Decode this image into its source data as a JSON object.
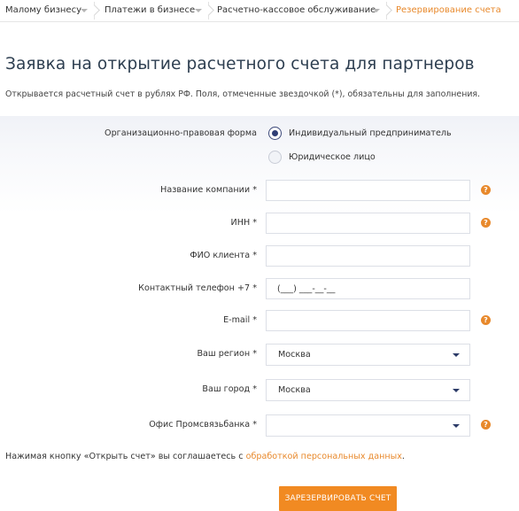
{
  "breadcrumb": {
    "items": [
      {
        "label": "Малому бизнесу"
      },
      {
        "label": "Платежи в бизнесе"
      },
      {
        "label": "Расчетно-кассовое обслуживание"
      },
      {
        "label": "Резервирование счета"
      }
    ]
  },
  "page": {
    "title": "Заявка на открытие расчетного счета для партнеров",
    "note": "Открывается расчетный счет в рублях РФ. Поля, отмеченные звездочкой (*), обязательны для заполнения."
  },
  "form": {
    "legal_form": {
      "label": "Организационно-правовая форма",
      "options": [
        {
          "label": "Индивидуальный предприниматель",
          "selected": true
        },
        {
          "label": "Юридическое лицо",
          "selected": false
        }
      ]
    },
    "company_name": {
      "label": "Название компании *",
      "value": ""
    },
    "inn": {
      "label": "ИНН *",
      "value": ""
    },
    "client_name": {
      "label": "ФИО клиента *",
      "value": ""
    },
    "phone": {
      "label": "Контактный телефон +7 *",
      "placeholder": "(___) ___-__-__"
    },
    "email": {
      "label": "E-mail *",
      "value": ""
    },
    "region": {
      "label": "Ваш регион  *",
      "value": "Москва"
    },
    "city": {
      "label": "Ваш город  *",
      "value": "Москва"
    },
    "office": {
      "label": "Офис Промсвязьбанка  *",
      "value": ""
    }
  },
  "help_icon_glyph": "?",
  "consent": {
    "text": "Нажимая кнопку «Открыть счет» вы соглашаетесь с ",
    "link": "обработкой персональных данных",
    "suffix": "."
  },
  "submit_label": "ЗАРЕЗЕРВИРОВАТЬ СЧЕТ",
  "colors": {
    "accent": "#f18a22",
    "breadcrumb_active": "#e8892c",
    "title": "#2d3e50",
    "radio_selected": "#2f3e75"
  }
}
